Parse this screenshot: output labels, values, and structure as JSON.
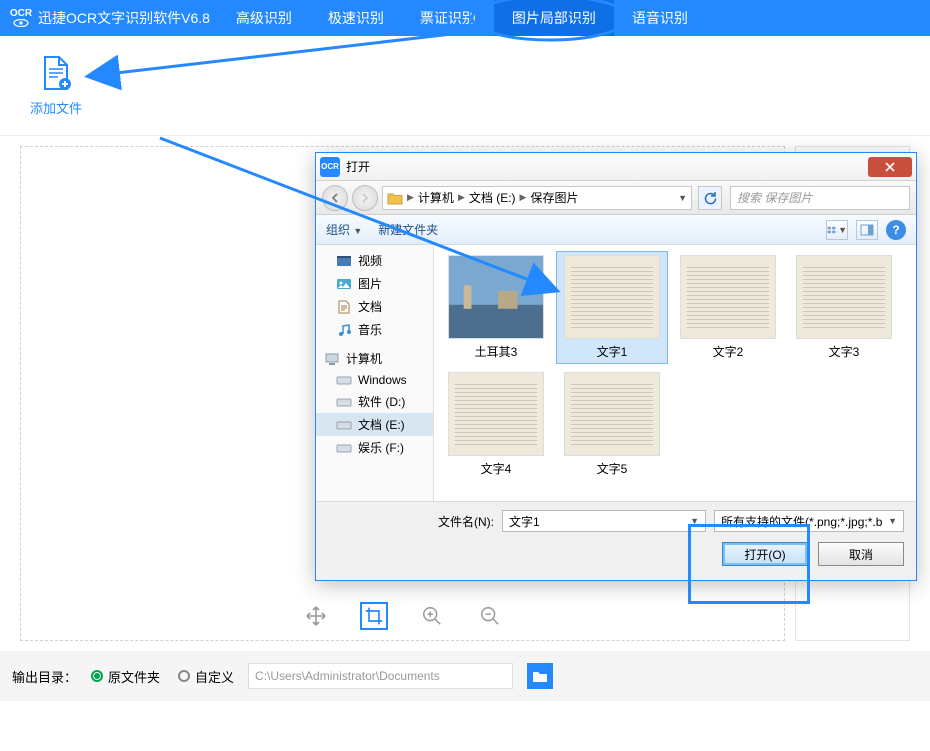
{
  "app": {
    "title": "迅捷OCR文字识别软件V6.8"
  },
  "tabs": {
    "items": [
      "高级识别",
      "极速识别",
      "票证识别",
      "图片局部识别",
      "语音识别"
    ],
    "activeIndex": 3
  },
  "toolbar": {
    "addFile": "添加文件"
  },
  "dialog": {
    "title": "打开",
    "breadcrumb": [
      "计算机",
      "文档 (E:)",
      "保存图片"
    ],
    "searchPlaceholder": "搜索 保存图片",
    "organize": "组织",
    "newFolder": "新建文件夹",
    "tree": {
      "library": [
        "视频",
        "图片",
        "文档",
        "音乐"
      ],
      "computer": "计算机",
      "drives": [
        "Windows",
        "软件 (D:)",
        "文档 (E:)",
        "娱乐 (F:)"
      ],
      "selectedDrive": "文档 (E:)"
    },
    "files": [
      {
        "name": "土耳其3",
        "kind": "photo",
        "selected": false
      },
      {
        "name": "文字1",
        "kind": "doc",
        "selected": true
      },
      {
        "name": "文字2",
        "kind": "doc",
        "selected": false
      },
      {
        "name": "文字3",
        "kind": "doc",
        "selected": false
      },
      {
        "name": "文字4",
        "kind": "doc",
        "selected": false
      },
      {
        "name": "文字5",
        "kind": "doc",
        "selected": false
      }
    ],
    "filenameLabel": "文件名(N):",
    "filenameValue": "文字1",
    "filetype": "所有支持的文件(*.png;*.jpg;*.b",
    "openBtn": "打开(O)",
    "cancelBtn": "取消"
  },
  "footer": {
    "label": "输出目录：",
    "option1": "原文件夹",
    "option2": "自定义",
    "path": "C:\\Users\\Administrator\\Documents"
  },
  "colors": {
    "accent": "#2489ff"
  }
}
